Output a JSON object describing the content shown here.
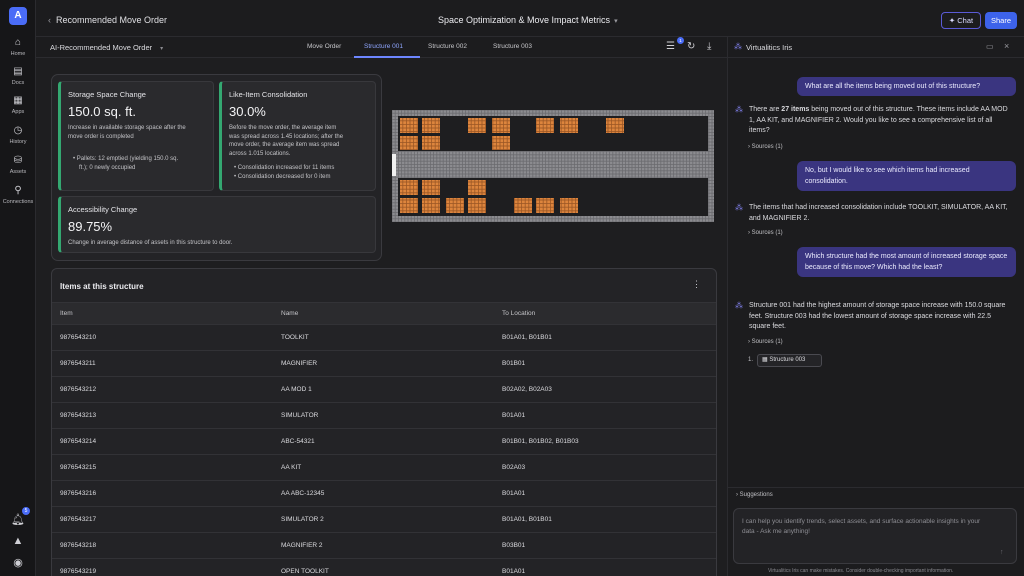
{
  "rail": {
    "logo": "A",
    "items": [
      {
        "label": "Home",
        "icon": "home-icon"
      },
      {
        "label": "Docs",
        "icon": "docs-icon"
      },
      {
        "label": "Apps",
        "icon": "apps-icon"
      },
      {
        "label": "History",
        "icon": "history-icon"
      },
      {
        "label": "Assets",
        "icon": "assets-icon"
      },
      {
        "label": "Connections",
        "icon": "connections-icon"
      }
    ],
    "notification_count": "5"
  },
  "topbar": {
    "back_title": "Recommended Move Order",
    "center_title": "Space Optimization & Move Impact Metrics",
    "chat_label": "Chat",
    "share_label": "Share"
  },
  "subbar": {
    "title": "AI-Recommended Move Order",
    "tabs": [
      "Move Order",
      "Structure 001",
      "Structure 002",
      "Structure 003"
    ],
    "active_tab": "Structure 001",
    "filter_badge": "1"
  },
  "metrics": {
    "storage": {
      "title": "Storage Space Change",
      "value": "150.0 sq. ft.",
      "desc_line1": "Increase in available storage space after the",
      "desc_line2": "move order is completed",
      "bullet_line1": "Pallets: 12 emptied (yielding 150.0 sq.",
      "bullet_line2": "ft.); 0 newly occupied"
    },
    "consolidation": {
      "title": "Like-Item Consolidation",
      "value": "30.0%",
      "desc_line1": "Before the move order, the average item",
      "desc_line2": "was spread across 1.45 locations; after the",
      "desc_line3": "move order, the average item was spread",
      "desc_line4": "across 1.015 locations.",
      "bullet1": "Consolidation increased for 11 items",
      "bullet2": "Consolidation decreased for 0 item"
    },
    "accessibility": {
      "title": "Accessibility Change",
      "value": "89.75%",
      "desc": "Change in average distance of assets in this structure to door."
    }
  },
  "table": {
    "title": "Items at this structure",
    "columns": [
      "Item",
      "Name",
      "To Location"
    ],
    "rows": [
      [
        "9876543210",
        "TOOLKIT",
        "B01A01, B01B01"
      ],
      [
        "9876543211",
        "MAGNIFIER",
        "B01B01"
      ],
      [
        "9876543212",
        "AA MOD 1",
        "B02A02, B02A03"
      ],
      [
        "9876543213",
        "SIMULATOR",
        "B01A01"
      ],
      [
        "9876543214",
        "ABC-54321",
        "B01B01, B01B02, B01B03"
      ],
      [
        "9876543215",
        "AA KIT",
        "B02A03"
      ],
      [
        "9876543216",
        "AA ABC-12345",
        "B01A01"
      ],
      [
        "9876543217",
        "SIMULATOR 2",
        "B01A01, B01B01"
      ],
      [
        "9876543218",
        "MAGNIFIER 2",
        "B03B01"
      ],
      [
        "9876543219",
        "OPEN TOOLKIT",
        "B01A01"
      ]
    ]
  },
  "chat": {
    "title": "Virtualitics Iris",
    "messages": {
      "u1": "What are all the items being moved out of this structure?",
      "b1_pre": "There are ",
      "b1_bold": "27 items",
      "b1_post": " being moved out of this structure. These items include AA MOD 1, AA KIT, and MAGNIFIER 2. Would you like to see a comprehensive list of all items?",
      "u2": "No, but I would like to see which items had increased consolidation.",
      "b2": "The items that had increased consolidation include TOOLKIT, SIMULATOR, AA KIT, and MAGNIFIER 2.",
      "u3": "Which structure had the most amount of increased storage space because of this move? Which had the least?",
      "b3": "Structure 001 had the highest amount of storage space increase with 150.0 square feet. Structure 003 had the lowest amount of storage space increase with 22.5 square feet.",
      "sources": "Sources (1)",
      "source_num": "1.",
      "source_chip": "Structure 003"
    },
    "suggestions_label": "Suggestions",
    "input_placeholder": "I can help you identify trends, select assets, and surface actionable insights in your data - Ask me anything!",
    "disclaimer": "Virtualitics Iris can make mistakes. Consider double-checking important information."
  },
  "colors": {
    "accent": "#3d63ea",
    "user_bubble": "#3a3580",
    "metric_bar": "#34a871",
    "pallet": "#d9803a"
  }
}
